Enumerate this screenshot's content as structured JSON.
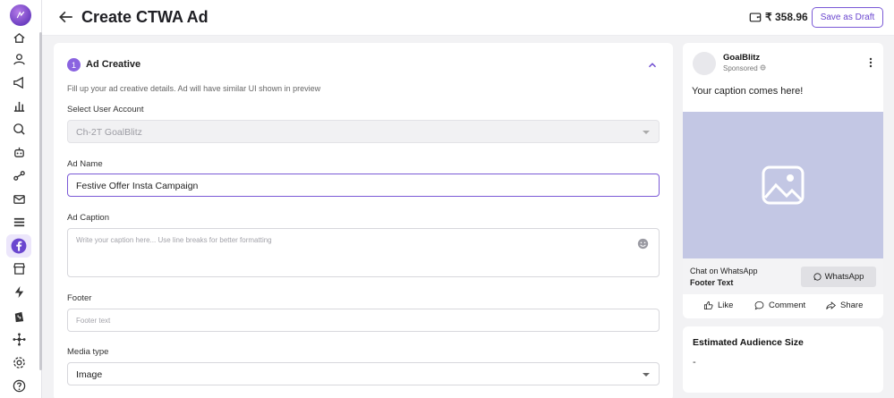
{
  "header": {
    "title": "Create CTWA Ad",
    "balance": "₹ 358.96",
    "save_draft_label": "Save as Draft"
  },
  "sidebar": {
    "icons": [
      "dashboard-icon",
      "user-icon",
      "megaphone-icon",
      "analytics-icon",
      "chat-search-icon",
      "bot-icon",
      "flow-icon",
      "mail-icon",
      "list-icon",
      "facebook-icon",
      "store-icon",
      "lightning-icon",
      "shopify-icon",
      "integration-icon",
      "settings-icon",
      "help-icon"
    ],
    "active": "facebook-icon"
  },
  "form": {
    "step_number": "1",
    "section_title": "Ad Creative",
    "hint": "Fill up your ad creative details. Ad will have similar UI shown in preview",
    "user_account": {
      "label": "Select User Account",
      "value": "Ch-2T GoalBlitz"
    },
    "ad_name": {
      "label": "Ad Name",
      "value": "Festive Offer Insta Campaign"
    },
    "ad_caption": {
      "label": "Ad Caption",
      "placeholder": "Write your caption here... Use line breaks for better formatting"
    },
    "footer": {
      "label": "Footer",
      "placeholder": "Footer text"
    },
    "media_type": {
      "label": "Media type",
      "value": "Image"
    }
  },
  "preview": {
    "brand": "GoalBlitz",
    "sponsored": "Sponsored",
    "caption": "Your caption comes here!",
    "cta_line1": "Chat on WhatsApp",
    "cta_line2": "Footer Text",
    "whatsapp_label": "WhatsApp",
    "like_label": "Like",
    "comment_label": "Comment",
    "share_label": "Share"
  },
  "audience": {
    "title": "Estimated Audience Size",
    "value": "-"
  },
  "colors": {
    "accent": "#7b5ad6",
    "media_placeholder": "#c3c7e4",
    "background": "#f2f2f4"
  }
}
